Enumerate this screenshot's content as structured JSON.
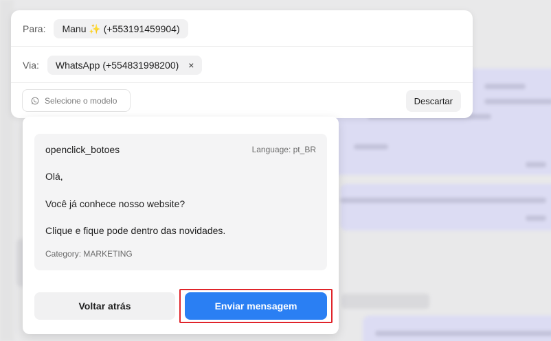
{
  "composer": {
    "to_label": "Para:",
    "to_contact": "Manu ✨ (+553191459904)",
    "via_label": "Via:",
    "via_channel": "WhatsApp (+554831998200)",
    "remove_symbol": "×",
    "template_placeholder": "Selecione o modelo",
    "discard_label": "Descartar"
  },
  "template": {
    "name": "openclick_botoes",
    "language": "Language: pt_BR",
    "body": [
      "Olá,",
      "Você já conhece nosso website?",
      "Clique e fique pode dentro das novidades."
    ],
    "category": "Category: MARKETING"
  },
  "actions": {
    "back_label": "Voltar atrás",
    "send_label": "Enviar mensagem"
  },
  "colors": {
    "primary": "#2a7ff3",
    "highlight": "#e0242a"
  }
}
